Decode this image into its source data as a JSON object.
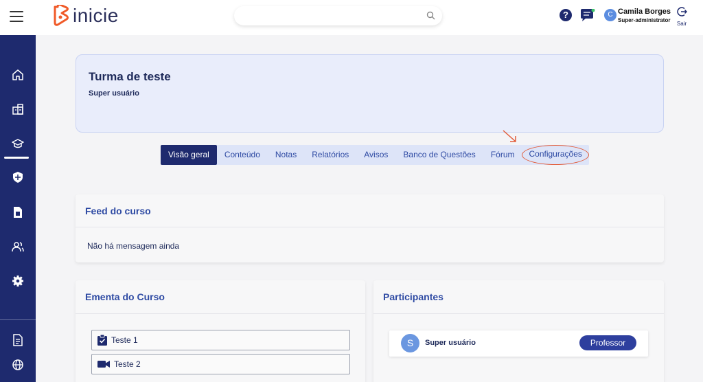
{
  "header": {
    "logo_text": "inicie",
    "search_placeholder": "",
    "user": {
      "initial": "C",
      "name": "Camila Borges",
      "role": "Super-administrator"
    },
    "logout_label": "Sair"
  },
  "sidebar": {
    "items": [
      {
        "icon": "home-icon"
      },
      {
        "icon": "building-icon"
      },
      {
        "icon": "graduation-cap-icon",
        "active": true
      },
      {
        "icon": "shield-icon"
      },
      {
        "icon": "document-icon"
      },
      {
        "icon": "users-icon"
      },
      {
        "icon": "gear-icon"
      },
      {
        "icon": "report-icon"
      },
      {
        "icon": "globe-icon"
      }
    ]
  },
  "class": {
    "title": "Turma de teste",
    "subtitle": "Super usuário"
  },
  "tabs": [
    {
      "label": "Visão geral",
      "active": true
    },
    {
      "label": "Conteúdo"
    },
    {
      "label": "Notas"
    },
    {
      "label": "Relatórios"
    },
    {
      "label": "Avisos"
    },
    {
      "label": "Banco de Questões"
    },
    {
      "label": "Fórum"
    },
    {
      "label": "Configurações",
      "highlighted": true
    }
  ],
  "feed": {
    "title": "Feed do curso",
    "empty_message": "Não há mensagem ainda"
  },
  "ementa": {
    "title": "Ementa do Curso",
    "lessons": [
      {
        "label": "Teste 1",
        "icon": "checklist-icon"
      },
      {
        "label": "Teste 2",
        "icon": "video-icon"
      }
    ]
  },
  "participants": {
    "title": "Participantes",
    "list": [
      {
        "initial": "S",
        "name": "Super usuário",
        "role": "Professor"
      }
    ]
  },
  "colors": {
    "primary": "#1e2a6e",
    "accent_blue": "#2e4aa3",
    "highlight": "#e25c3a",
    "logo_orange": "#f05a28"
  }
}
